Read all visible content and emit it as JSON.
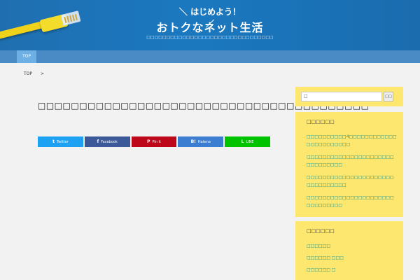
{
  "header": {
    "tagline": "＼ はじめよう！ ／",
    "title": "おトクなネット生活",
    "description": "□□□□□□□□□□□□□□□□□□□□□□□□□□□□□□□□"
  },
  "nav": {
    "top_label": "TOP"
  },
  "breadcrumb": {
    "home": "TOP",
    "separator": ">"
  },
  "article": {
    "title": "□□□□□□□□□□□□□□□□□□□□□□□□□□□□□□□□□□□□□□□□",
    "share": [
      {
        "label": "Twitter",
        "icon": "t",
        "color": "#1da1f2"
      },
      {
        "label": "Facebook",
        "icon": "f",
        "color": "#3b5998"
      },
      {
        "label": "Pin it",
        "icon": "P",
        "color": "#bd081c"
      },
      {
        "label": "Hatena",
        "icon": "B!",
        "color": "#3c7dd1"
      },
      {
        "label": "LINE",
        "icon": "L",
        "color": "#00c300"
      }
    ]
  },
  "sidebar": {
    "search": {
      "placeholder": "□",
      "button_label": "□□"
    },
    "recent": {
      "title": "□□□□□□",
      "items": [
        "□□□□□□□□□□4□□□□□□□□□□□□□□□□□□□□□□□",
        "□□□□□□□□□□□□□□□□□□□□□□□□□□□□□□□",
        "□□□□□□□□□□□□□□□□□□□□□□□□□□□□□□□□",
        "□□□□□□□□□□□□□□□□□□□□□□□□□□□□□□□"
      ]
    },
    "categories": {
      "title": "□□□□□□",
      "items": [
        "□□□□□□",
        "□□□□□□ □□□",
        "□□□□□□ □"
      ]
    }
  }
}
